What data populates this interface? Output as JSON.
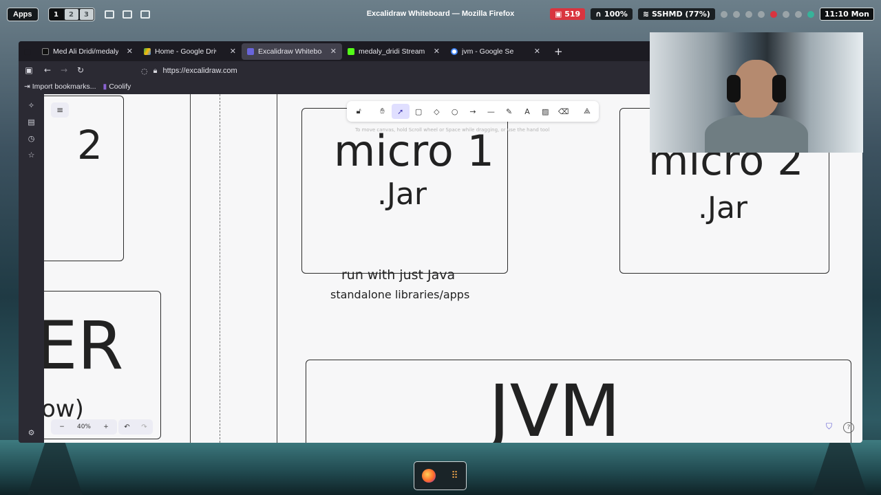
{
  "panel": {
    "apps_label": "Apps",
    "workspaces": [
      "1",
      "2",
      "3"
    ],
    "window_title": "Excalidraw Whiteboard — Mozilla Firefox",
    "notification_count": "519",
    "volume": "100%",
    "wifi": "SSHMD (77%)",
    "clock": "11:10 Mon"
  },
  "browser": {
    "tabs": [
      {
        "label": "Med Ali Dridi/medaly.dr",
        "icon": "github-icon",
        "active": false
      },
      {
        "label": "Home - Google Drive",
        "icon": "drive-icon",
        "active": false
      },
      {
        "label": "Excalidraw Whiteboard",
        "icon": "excalidraw-icon",
        "active": true
      },
      {
        "label": "medaly_dridi Stream - V",
        "icon": "kick-icon",
        "active": false
      },
      {
        "label": "jvm - Google Search",
        "icon": "google-icon",
        "active": false
      }
    ],
    "url": "https://excalidraw.com",
    "bookmarks": [
      {
        "label": "Import bookmarks...",
        "icon": "import-icon"
      },
      {
        "label": "Coolify",
        "icon": "coolify-icon"
      }
    ]
  },
  "excalidraw": {
    "hint": "To move canvas, hold Scroll wheel or Space while dragging, or use the hand tool",
    "zoom": "40%",
    "shapes": {
      "left_top_text": "2",
      "left_bottom_text": "ER",
      "left_bottom_sub": "ow)",
      "micro1_title": "micro 1",
      "micro1_sub": ".Jar",
      "micro1_line1": "run with just Java",
      "micro1_line2": "standalone libraries/apps",
      "micro2_title": "micro 2",
      "micro2_sub": ".Jar",
      "jvm_text": "JVM"
    },
    "tools": [
      "lock-icon",
      "hand-icon",
      "selection-icon",
      "rectangle-icon",
      "diamond-icon",
      "ellipse-icon",
      "arrow-icon",
      "line-icon",
      "pencil-icon",
      "text-icon",
      "image-icon",
      "eraser-icon",
      "more-tools-icon"
    ]
  },
  "colors": {
    "tool_selected_bg": "#e0dfff",
    "notification_red": "#d9343f",
    "canvas_bg": "#f7f7f8"
  }
}
